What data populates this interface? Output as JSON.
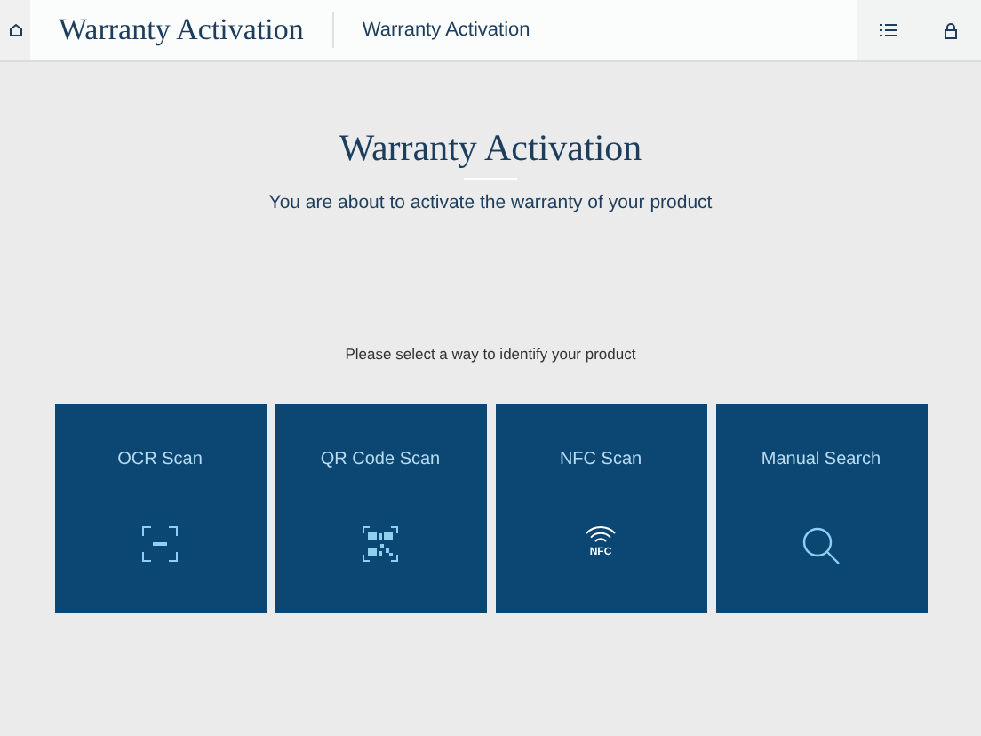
{
  "header": {
    "title": "Warranty Activation",
    "subtitle": "Warranty Activation"
  },
  "heading": "Warranty Activation",
  "intro": "You are about to activate the warranty of your product",
  "prompt": "Please select a way to identify your product",
  "options": [
    {
      "label": "OCR Scan",
      "kind": "ocr"
    },
    {
      "label": "QR Code Scan",
      "kind": "qr"
    },
    {
      "label": "NFC Scan",
      "kind": "nfc",
      "icon_text": "NFC"
    },
    {
      "label": "Manual Search",
      "kind": "search"
    }
  ]
}
